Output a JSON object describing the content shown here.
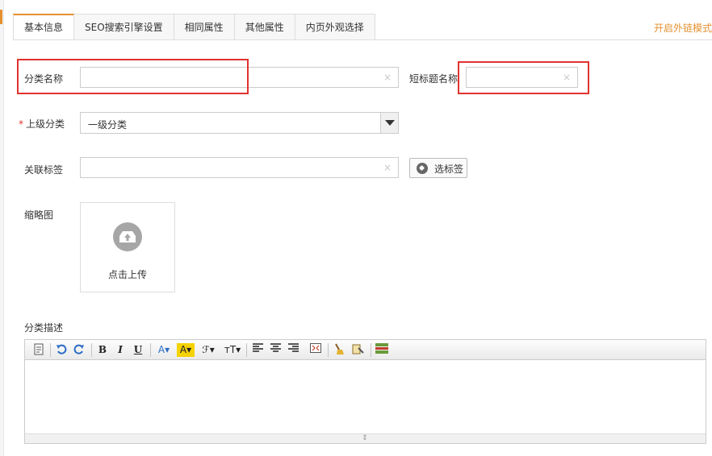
{
  "tabs": [
    "基本信息",
    "SEO搜索引擎设置",
    "相同属性",
    "其他属性",
    "内页外观选择"
  ],
  "ext_link": "开启外链模式",
  "fields": {
    "category_name": {
      "label": "分类名称",
      "value": "",
      "clear": "×"
    },
    "short_title": {
      "label": "短标题名称",
      "value": "",
      "clear": "×"
    },
    "parent": {
      "required_mark": "*",
      "label": "上级分类",
      "value": "一级分类"
    },
    "tags": {
      "label": "关联标签",
      "value": "",
      "clear": "×",
      "button": "选标签"
    },
    "thumbnail": {
      "label": "缩略图",
      "upload_text": "点击上传"
    },
    "description": {
      "label": "分类描述"
    }
  },
  "toolbar": {
    "bold": "B",
    "italic": "I",
    "underline": "U",
    "font_color": "A▾",
    "bg_color": "A▾",
    "font_family": "ℱ▾",
    "font_size": "ᴛT▾"
  },
  "editor": {
    "content": "",
    "resize_grip": "⇕"
  },
  "colors": {
    "accent": "#e5902f",
    "highlight_box": "#e0322f"
  }
}
